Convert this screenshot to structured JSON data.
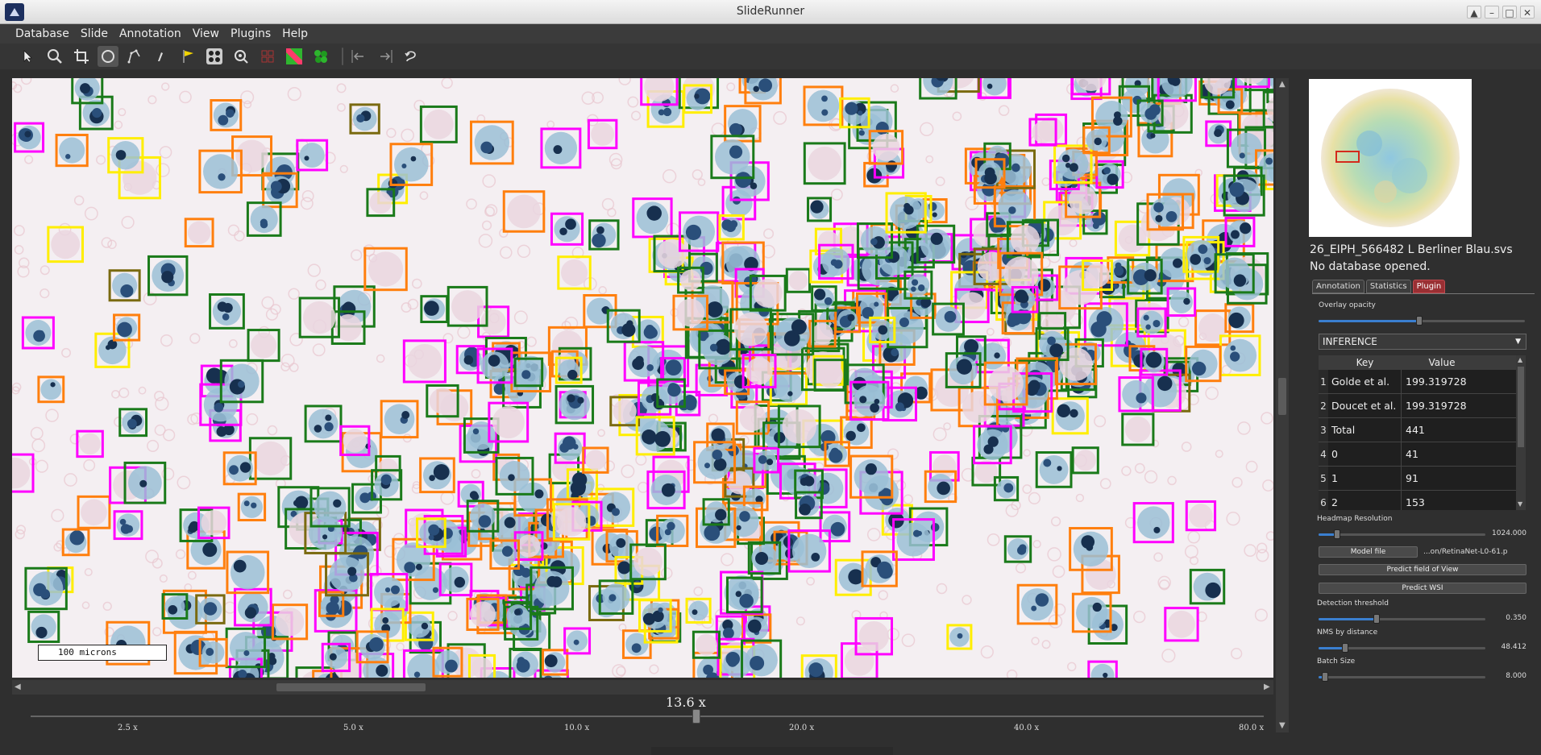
{
  "window": {
    "title": "SlideRunner",
    "controls": [
      "▲",
      "–",
      "□",
      "✕"
    ]
  },
  "menubar": {
    "items": [
      "Database",
      "Slide",
      "Annotation",
      "View",
      "Plugins",
      "Help"
    ]
  },
  "toolbar": {
    "icons": [
      "pointer-icon",
      "magnifier-icon",
      "crop-icon",
      "circle-select-icon",
      "polygon-icon",
      "pen-icon",
      "flag-icon",
      "dots-icon",
      "zoom-to-fit-icon",
      "grid-off-icon",
      "overlay-green-icon",
      "green-cells-icon",
      "back-icon",
      "forward-icon",
      "redo-icon"
    ]
  },
  "viewer": {
    "scalebar_label": "100 microns",
    "zoom_label": "13.6 x",
    "zoom_ticks": [
      "2.5 x",
      "5.0 x",
      "10.0 x",
      "20.0 x",
      "40.0 x",
      "80.0 x"
    ],
    "zoom_fraction": 0.54
  },
  "panel": {
    "filename": "26_EIPH_566482 L Berliner Blau.svs",
    "db_status": "No database opened.",
    "tabs": [
      "Annotation",
      "Statistics",
      "Plugin"
    ],
    "active_tab": "Plugin",
    "overlay_opacity_label": "Overlay opacity",
    "overlay_opacity_fraction": 0.49,
    "plugin_select": "INFERENCE",
    "table": {
      "headers": [
        "Key",
        "Value"
      ],
      "rows": [
        {
          "idx": "1",
          "key": "Golde et al.",
          "value": "199.319728"
        },
        {
          "idx": "2",
          "key": "Doucet et al.",
          "value": "199.319728"
        },
        {
          "idx": "3",
          "key": "Total",
          "value": "441"
        },
        {
          "idx": "4",
          "key": "0",
          "value": "41"
        },
        {
          "idx": "5",
          "key": "1",
          "value": "91"
        },
        {
          "idx": "6",
          "key": "2",
          "value": "153"
        }
      ]
    },
    "heatmap_label": "Headmap Resolution",
    "heatmap_value": "1024.000",
    "heatmap_fraction": 0.11,
    "model_file_button": "Model file",
    "model_path": "...on/RetinaNet-L0-61.p",
    "predict_fov_button": "Predict field of View",
    "predict_wsi_button": "Predict WSI",
    "detection_label": "Detection threshold",
    "detection_value": "0.350",
    "detection_fraction": 0.35,
    "nms_label": "NMS by distance",
    "nms_value": "48.412",
    "nms_fraction": 0.16,
    "batch_label": "Batch Size",
    "batch_value": "8.000",
    "batch_fraction": 0.04
  },
  "colors": {
    "accent_tab": "#9a2f33",
    "slider_fill": "#3a7fd0",
    "box_classes": [
      "#1a7a1a",
      "#ff7f0e",
      "#ff00ff",
      "#ffee00",
      "#7a6a10"
    ]
  }
}
